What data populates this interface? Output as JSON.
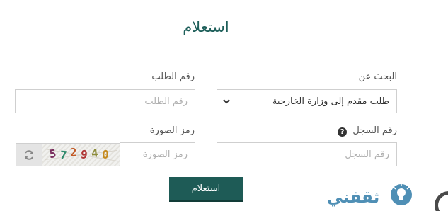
{
  "header": {
    "title": "استعلام"
  },
  "form": {
    "search_by": {
      "label": "البحث عن",
      "selected": "طلب مقدم إلى وزارة الخارجية"
    },
    "request_number": {
      "label": "رقم الطلب",
      "placeholder": "رقم الطلب"
    },
    "record_number": {
      "label": "رقم السجل",
      "placeholder": "رقم السجل",
      "icon": "question-circle-icon"
    },
    "captcha_code": {
      "label": "رمز الصورة",
      "placeholder": "رمز الصورة"
    },
    "captcha_image_text": "572940",
    "refresh_icon": "refresh-icon",
    "submit_label": "استعلام"
  },
  "watermark": {
    "text": "ثقفني",
    "icon": "lightbulb-icon"
  },
  "colors": {
    "accent": "#1e5f5a",
    "button": "#1e5b56"
  }
}
